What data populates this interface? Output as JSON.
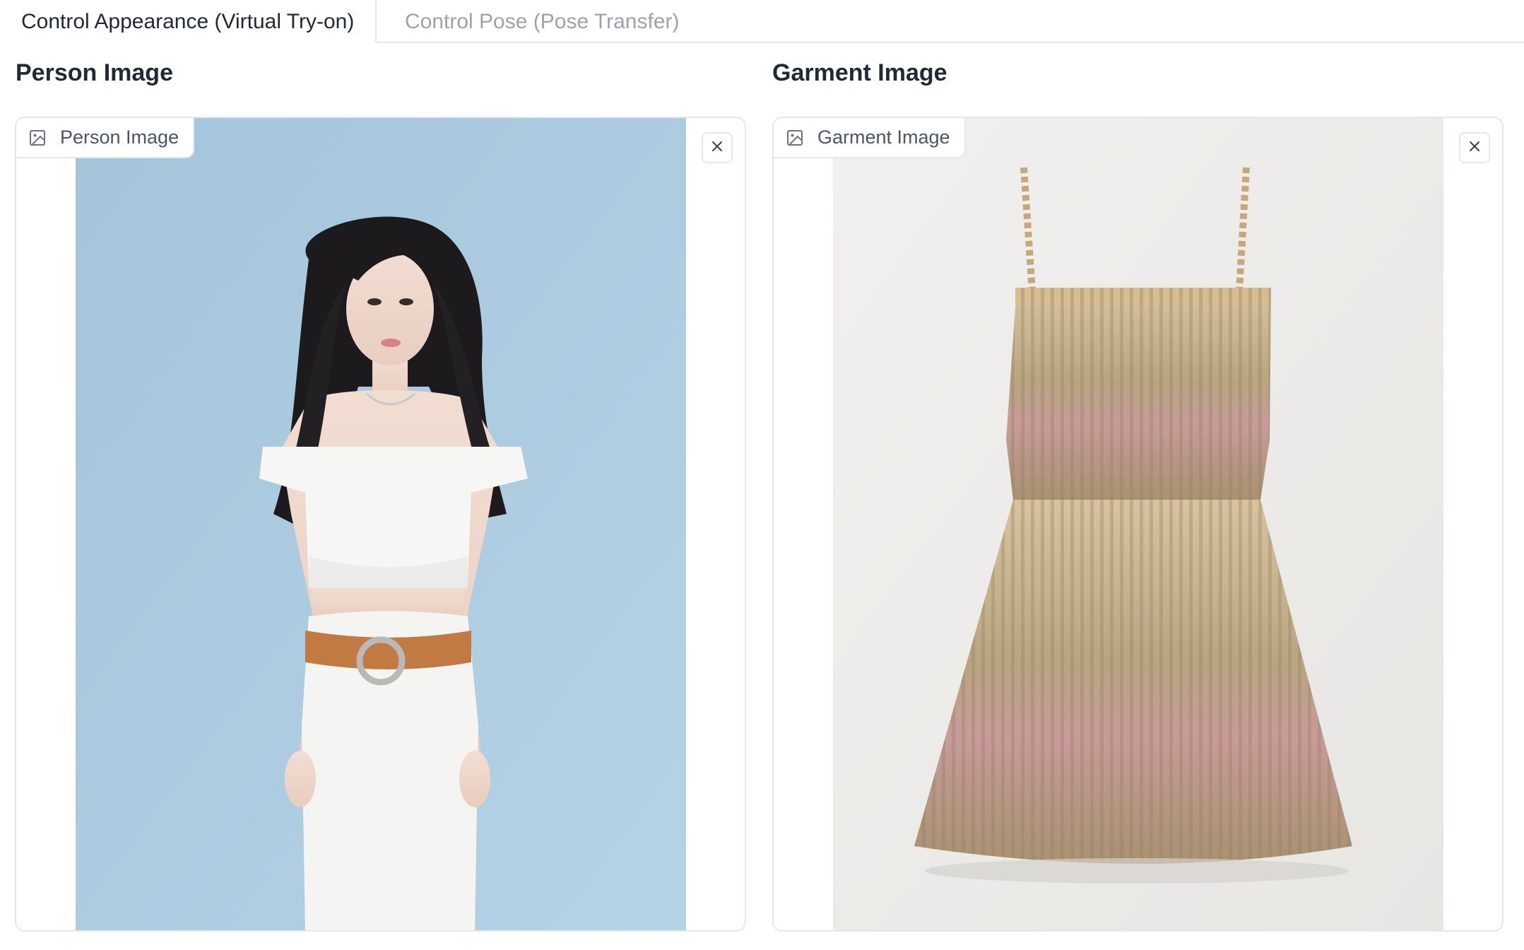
{
  "tabs": [
    {
      "label": "Control Appearance (Virtual Try-on)",
      "active": true
    },
    {
      "label": "Control Pose (Pose Transfer)",
      "active": false
    }
  ],
  "person": {
    "section_title": "Person Image",
    "chip_label": "Person Image",
    "icon": "image-icon",
    "clear_icon": "close-icon"
  },
  "garment": {
    "section_title": "Garment Image",
    "chip_label": "Garment Image",
    "icon": "image-icon",
    "clear_icon": "close-icon"
  },
  "colors": {
    "person_background": "#a9c9df",
    "garment_background": "#eeedeb",
    "border": "#e5e7eb",
    "inactive_tab_text": "#9ca3af"
  }
}
